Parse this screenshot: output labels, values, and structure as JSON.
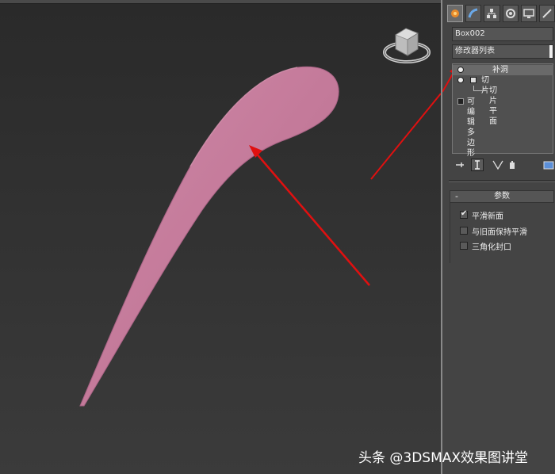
{
  "viewport": {
    "object_color": "#c47a9a",
    "arrow_color": "#e01010"
  },
  "panel": {
    "tabs": [
      {
        "name": "create-tab-icon",
        "active": true
      },
      {
        "name": "modify-tab-icon",
        "active": false
      },
      {
        "name": "hierarchy-tab-icon",
        "active": false
      },
      {
        "name": "motion-tab-icon",
        "active": false
      },
      {
        "name": "display-tab-icon",
        "active": false
      },
      {
        "name": "utilities-tab-icon",
        "active": false
      }
    ],
    "object_name": "Box002",
    "modifier_list_label": "修改器列表",
    "stack": {
      "patch": "补洞",
      "slice": "切片",
      "slice_plane": "切片平面",
      "edit_poly": "可编辑多边形"
    },
    "rollout": {
      "minus": "-",
      "title": "参数"
    },
    "options": {
      "smooth_new_faces": "平滑新面",
      "smooth_with_old_faces": "与旧面保持平滑",
      "triangulate_cap": "三角化封口"
    },
    "checked": {
      "smooth_new_faces": true,
      "smooth_with_old_faces": false,
      "triangulate_cap": false
    }
  },
  "watermark": "头条 @3DSMAX效果图讲堂"
}
